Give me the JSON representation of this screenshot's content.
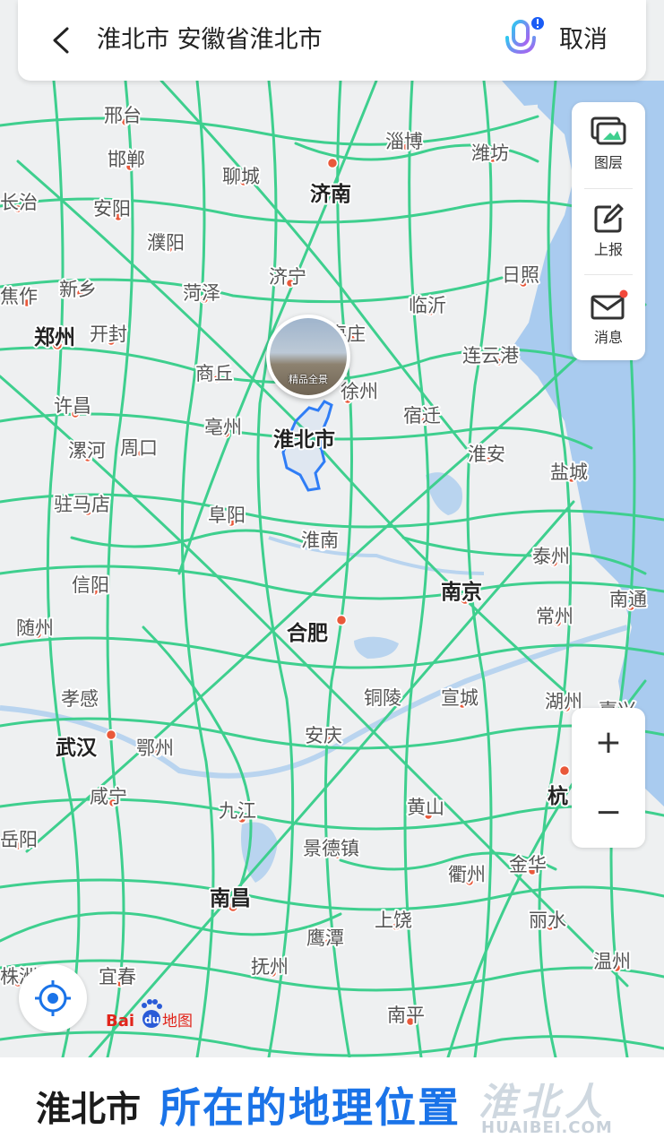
{
  "header": {
    "search_text": "淮北市 安徽省淮北市",
    "cancel_label": "取消",
    "back_icon": "chevron-left-icon",
    "voice_icon": "microphone-icon"
  },
  "side_panel": {
    "items": [
      {
        "label": "图层",
        "icon": "layers-icon"
      },
      {
        "label": "上报",
        "icon": "report-edit-icon"
      },
      {
        "label": "消息",
        "icon": "mail-icon"
      }
    ]
  },
  "zoom": {
    "in_label": "+",
    "out_label": "−"
  },
  "panorama": {
    "label": "精品全景"
  },
  "map": {
    "target_city": "淮北市",
    "cities": [
      "邢台",
      "淄博",
      "邯郸",
      "潍坊",
      "聊城",
      "济南",
      "长治",
      "安阳",
      "濮阳",
      "新乡",
      "济宁",
      "菏泽",
      "日照",
      "焦作",
      "临沂",
      "郑州",
      "开封",
      "枣庄",
      "商丘",
      "连云港",
      "许昌",
      "徐州",
      "宿迁",
      "亳州",
      "漯河",
      "周口",
      "淮安",
      "盐城",
      "驻马店",
      "阜阳",
      "淮南",
      "泰州",
      "信阳",
      "南京",
      "南通",
      "常州",
      "随州",
      "合肥",
      "孝感",
      "铜陵",
      "宣城",
      "湖州",
      "嘉兴",
      "武汉",
      "鄂州",
      "安庆",
      "咸宁",
      "杭",
      "九江",
      "黄山",
      "岳阳",
      "景德镇",
      "金华",
      "衢州",
      "南昌",
      "上饶",
      "丽水",
      "鹰潭",
      "抚州",
      "温州",
      "株洲",
      "宜春",
      "南平"
    ],
    "colors": {
      "highway": "#3ecf8e",
      "land": "#eef0f1",
      "water": "#a9cbef",
      "city_dot": "#e9583a",
      "target_outline": "#2f7df6"
    }
  },
  "logo": {
    "text_bai": "Bai",
    "text_du": "du",
    "text_map": "地图"
  },
  "caption": {
    "city": "淮北市",
    "title": "所在的地理位置",
    "watermark_cn": "淮北人",
    "watermark_url": "HUAIBEI.COM"
  }
}
